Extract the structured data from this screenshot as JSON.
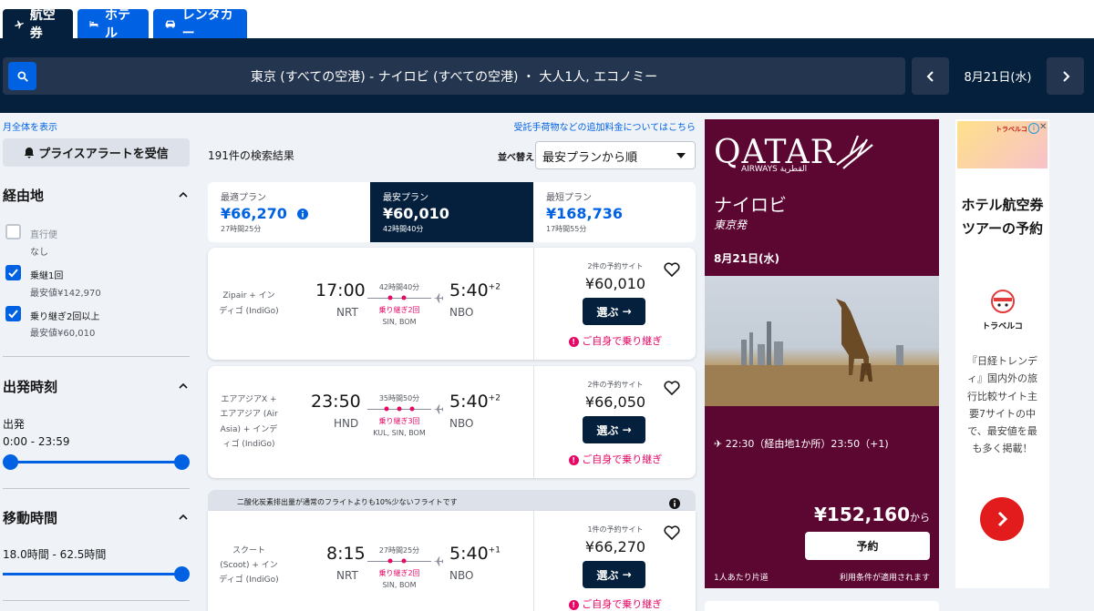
{
  "tabs": [
    {
      "label": "航空券",
      "active": true
    },
    {
      "label": "ホテル",
      "active": false
    },
    {
      "label": "レンタカー",
      "active": false
    }
  ],
  "search": {
    "summary": "東京 (すべての空港) - ナイロビ (すべての空港) ・ 大人1人, エコノミー",
    "date": "8月21日(水)"
  },
  "sidebar": {
    "month_link": "月全体を表示",
    "alert_button": "プライスアラートを受信",
    "stops": {
      "title": "経由地",
      "options": [
        {
          "label": "直行便",
          "sub": "なし",
          "checked": false
        },
        {
          "label": "乗継1回",
          "sub": "最安値¥142,970",
          "checked": true
        },
        {
          "label": "乗り継ぎ2回以上",
          "sub": "最安値¥60,010",
          "checked": true
        }
      ]
    },
    "departure": {
      "title": "出発時刻",
      "label": "出発",
      "range": "0:00 - 23:59"
    },
    "duration": {
      "title": "移動時間",
      "range": "18.0時間 - 62.5時間"
    }
  },
  "results": {
    "fees_link": "受託手荷物などの追加料金についてはこちら",
    "count": "191件の検索結果",
    "sort_label": "並べ替え",
    "sort_value": "最安プランから順",
    "segments": [
      {
        "label": "最適プラン",
        "price": "¥66,270",
        "duration": "27時間25分"
      },
      {
        "label": "最安プラン",
        "price": "¥60,010",
        "duration": "42時間40分"
      },
      {
        "label": "最短プラン",
        "price": "¥168,736",
        "duration": "17時間55分"
      }
    ],
    "eco_banner": "二酸化炭素排出量が通常のフライトよりも10%少ないフライトです",
    "flights": [
      {
        "airline": "Zipair + インディゴ (IndiGo)",
        "dep_time": "17:00",
        "dep_code": "NRT",
        "duration": "42時間40分",
        "stops": "乗り継ぎ2回",
        "via": "SIN, BOM",
        "arr_time": "5:40",
        "arr_plus": "+2",
        "arr_code": "NBO",
        "sites": "2件の予約サイト",
        "price": "¥60,010",
        "select": "選ぶ",
        "self_transfer": "ご自身で乗り継ぎ"
      },
      {
        "airline": "エアアジアX + エアアジア (Air Asia) + インディゴ (IndiGo)",
        "dep_time": "23:50",
        "dep_code": "HND",
        "duration": "35時間50分",
        "stops": "乗り継ぎ3回",
        "via": "KUL, SIN, BOM",
        "arr_time": "5:40",
        "arr_plus": "+2",
        "arr_code": "NBO",
        "sites": "2件の予約サイト",
        "price": "¥66,050",
        "select": "選ぶ",
        "self_transfer": "ご自身で乗り継ぎ"
      },
      {
        "airline": "スクート (Scoot) + インディゴ (IndiGo)",
        "dep_time": "8:15",
        "dep_code": "NRT",
        "duration": "27時間25分",
        "stops": "乗り継ぎ2回",
        "via": "SIN, BOM",
        "arr_time": "5:40",
        "arr_plus": "+1",
        "arr_code": "NBO",
        "sites": "1件の予約サイト",
        "price": "¥66,270",
        "select": "選ぶ",
        "self_transfer": "ご自身で乗り継ぎ"
      }
    ]
  },
  "ad_qatar": {
    "brand": "QATAR",
    "brand_sub": "AIRWAYS القطرية",
    "city": "ナイロビ",
    "from": "東京発",
    "date": "8月21日(水)",
    "schedule": "22:30（経由地1か所）23:50（+1)",
    "price": "¥152,160",
    "price_suffix": "から",
    "button": "予約",
    "footnote_left": "1人あたり片道",
    "footnote_right": "利用条件が適用されます"
  },
  "ad_travel": {
    "title": "ホテル航空券ツアーの予約",
    "logo_text": "トラベルコ",
    "body": "『日経トレンディ』国内外の旅行比較サイト主要7サイトの中で、最安値を最も多く掲載！",
    "banner_top": "トラベルコ"
  },
  "colors": {
    "brand_blue": "#0062e3",
    "navy": "#05203c",
    "pink": "#e70866",
    "qatar": "#5c0632"
  }
}
